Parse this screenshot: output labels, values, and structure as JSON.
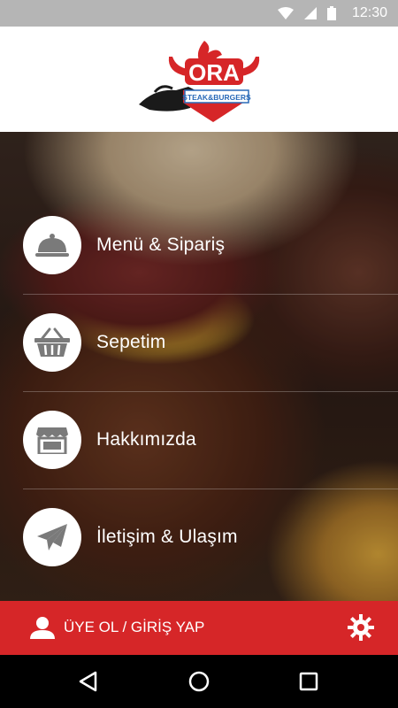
{
  "status_bar": {
    "time": "12:30",
    "icons": [
      "wifi-icon",
      "signal-icon",
      "battery-icon"
    ]
  },
  "header": {
    "logo_text": "ORA",
    "logo_subtext": "STEAK&BURGERS"
  },
  "menu": {
    "items": [
      {
        "label": "Menü & Sipariş",
        "icon": "cloche-icon"
      },
      {
        "label": "Sepetim",
        "icon": "basket-icon"
      },
      {
        "label": "Hakkımızda",
        "icon": "storefront-icon"
      },
      {
        "label": "İletişim & Ulaşım",
        "icon": "paper-plane-icon"
      }
    ]
  },
  "account_bar": {
    "login_label": "ÜYE OL / GİRİŞ YAP",
    "user_icon": "user-icon",
    "settings_icon": "gear-icon"
  },
  "nav_bar": {
    "buttons": [
      "back-icon",
      "home-icon",
      "recents-icon"
    ]
  },
  "colors": {
    "brand_red": "#d62628",
    "status_bar": "#b5b5b5",
    "icon_gray": "#7a7a7a"
  }
}
